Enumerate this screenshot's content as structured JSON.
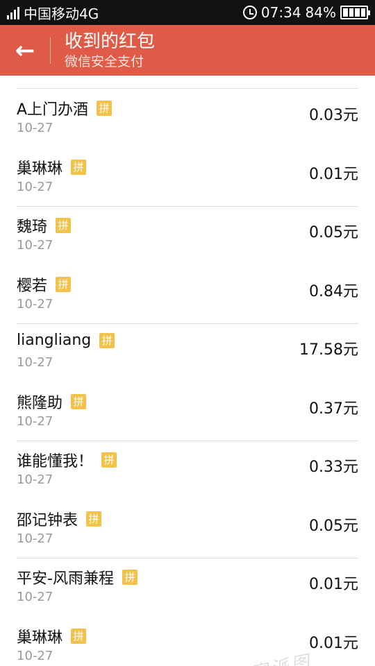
{
  "status_bar": {
    "carrier": "中国移动4G",
    "time": "07:34",
    "battery": "84%",
    "battery_level": 0.84
  },
  "header": {
    "back_icon": "arrow-left-icon",
    "title": "收到的红包",
    "subtitle": "微信安全支付"
  },
  "pin_label": "拼",
  "items": [
    {
      "name": "A上门办酒",
      "date": "10-27",
      "amount": "0.03元"
    },
    {
      "name": "巢琳琳",
      "date": "10-27",
      "amount": "0.01元"
    },
    {
      "name": "魏琦",
      "date": "10-27",
      "amount": "0.05元"
    },
    {
      "name": "樱若",
      "date": "10-27",
      "amount": "0.84元"
    },
    {
      "name": "liangliang",
      "date": "10-27",
      "amount": "17.58元"
    },
    {
      "name": "熊隆助",
      "date": "10-27",
      "amount": "0.37元"
    },
    {
      "name": "谁能懂我！",
      "date": "10-27",
      "amount": "0.33元"
    },
    {
      "name": "邵记钟表",
      "date": "10-27",
      "amount": "0.05元"
    },
    {
      "name": "平安-风雨兼程",
      "date": "10-27",
      "amount": "0.01元"
    },
    {
      "name": "巢琳琳",
      "date": "10-27",
      "amount": "0.01元"
    }
  ]
}
